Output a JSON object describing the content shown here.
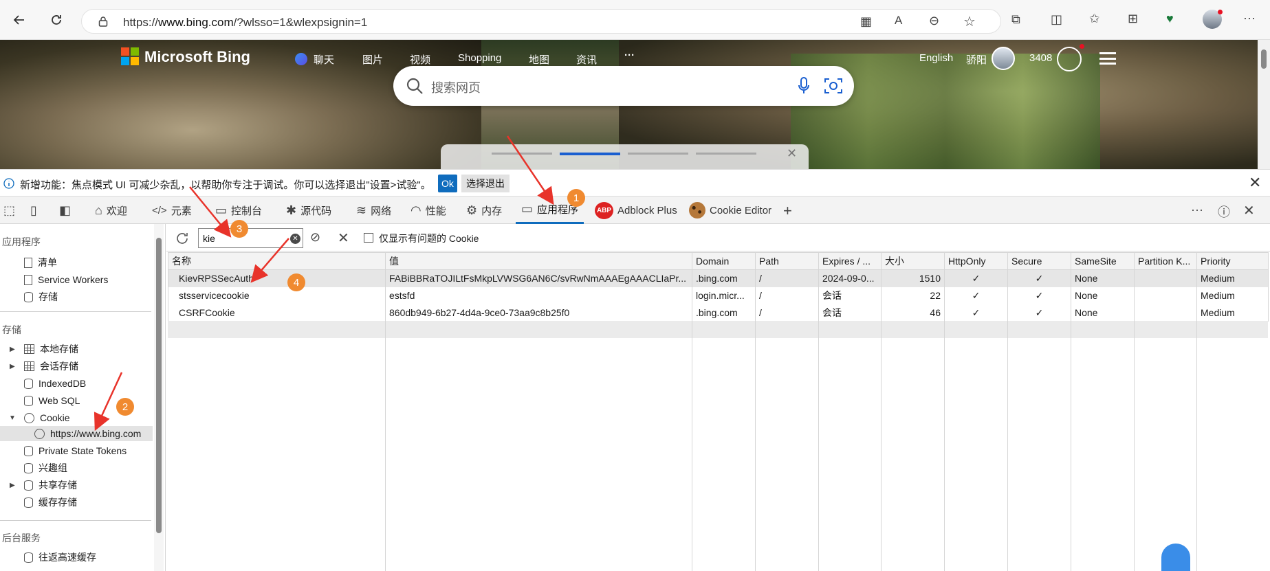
{
  "browser": {
    "url_prefix": "https://",
    "url_host": "www.bing.com",
    "url_rest": "/?wlsso=1&wlexpsignin=1"
  },
  "bing": {
    "brand": "Microsoft Bing",
    "nav": [
      "聊天",
      "图片",
      "视频",
      "Shopping",
      "地图",
      "资讯",
      "···"
    ],
    "search_placeholder": "搜索网页",
    "language": "English",
    "user_name": "骄阳",
    "points": "3408"
  },
  "notice": {
    "text": "新增功能：焦点模式 UI 可减少杂乱，以帮助你专注于调试。你可以选择退出\"设置>试验\"。",
    "ok_label": "Ok",
    "exit_label": "选择退出"
  },
  "devtools_tabs": [
    {
      "label": "欢迎",
      "icon": "home-icon"
    },
    {
      "label": "元素",
      "icon": "code-icon"
    },
    {
      "label": "控制台",
      "icon": "console-icon"
    },
    {
      "label": "源代码",
      "icon": "bug-icon"
    },
    {
      "label": "网络",
      "icon": "wifi-icon"
    },
    {
      "label": "性能",
      "icon": "gauge-icon"
    },
    {
      "label": "内存",
      "icon": "chip-icon"
    },
    {
      "label": "应用程序",
      "icon": "window-icon"
    },
    {
      "label": "Adblock Plus",
      "icon": "abp-icon"
    },
    {
      "label": "Cookie Editor",
      "icon": "cookie-icon"
    }
  ],
  "sidebar": {
    "app_heading": "应用程序",
    "app_items": [
      "清单",
      "Service Workers",
      "存储"
    ],
    "storage_heading": "存储",
    "storage_items": [
      "本地存储",
      "会话存储",
      "IndexedDB",
      "Web SQL",
      "Cookie"
    ],
    "cookie_child": "https://www.bing.com",
    "more_items": [
      "Private State Tokens",
      "兴趣组",
      "共享存储",
      "缓存存储"
    ],
    "bg_heading": "后台服务",
    "bg_items": [
      "往返高速缓存"
    ]
  },
  "filter": {
    "value": "kie",
    "only_issues_label": "仅显示有问题的 Cookie"
  },
  "table": {
    "headers": [
      "名称",
      "值",
      "Domain",
      "Path",
      "Expires / ...",
      "大小",
      "HttpOnly",
      "Secure",
      "SameSite",
      "Partition K...",
      "Priority"
    ],
    "rows": [
      [
        "KievRPSSecAuth",
        "FABiBBRaTOJILtFsMkpLVWSG6AN6C/svRwNmAAAEgAAACLIaPr...",
        ".bing.com",
        "/",
        "2024-09-0...",
        "1510",
        "✓",
        "✓",
        "None",
        "",
        "Medium"
      ],
      [
        "stsservicecookie",
        "estsfd",
        "login.micr...",
        "/",
        "会话",
        "22",
        "✓",
        "✓",
        "None",
        "",
        "Medium"
      ],
      [
        "CSRFCookie",
        "860db949-6b27-4d4a-9ce0-73aa9c8b25f0",
        ".bing.com",
        "/",
        "会话",
        "46",
        "✓",
        "✓",
        "None",
        "",
        "Medium"
      ]
    ]
  },
  "badges": [
    "1",
    "2",
    "3",
    "4"
  ],
  "colors": {
    "accent": "#0f6cbd",
    "badge": "#f08a30",
    "arrow": "#e8332a"
  }
}
